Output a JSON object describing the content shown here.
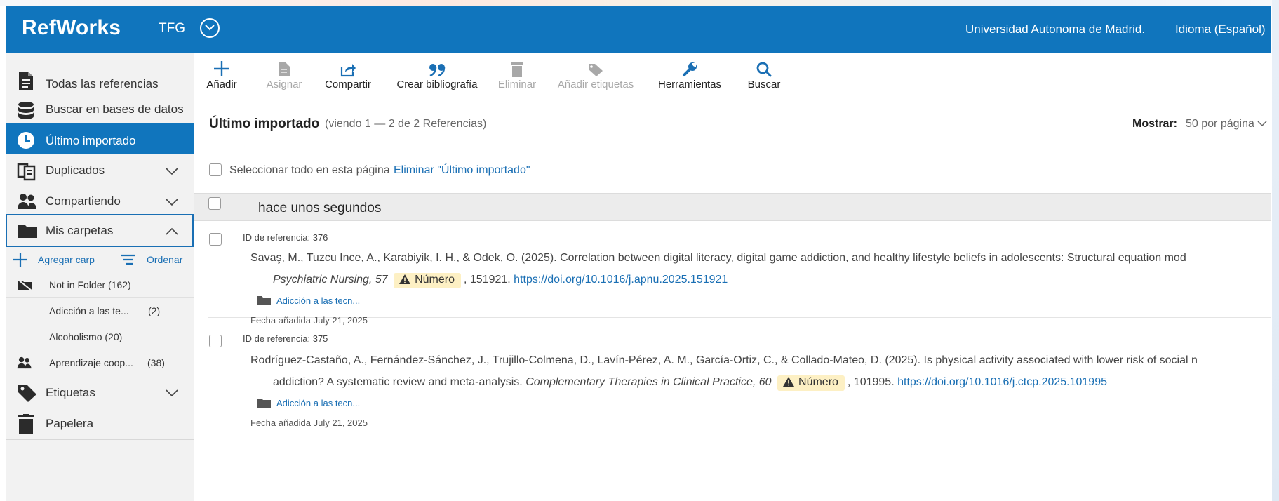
{
  "header": {
    "logo": "RefWorks",
    "project": "TFG",
    "institution": "Universidad Autonoma de Madrid.",
    "language": "Idioma (Español)"
  },
  "sidebar": {
    "items": [
      {
        "label": "Todas las referencias",
        "icon": "document-icon"
      },
      {
        "label": "Buscar en bases de datos",
        "icon": "database-icon"
      },
      {
        "label": "Último importado",
        "icon": "clock-icon",
        "active": true
      },
      {
        "label": "Duplicados",
        "icon": "duplicate-icon"
      },
      {
        "label": "Compartiendo",
        "icon": "users-icon"
      },
      {
        "label": "Mis carpetas",
        "icon": "folder-icon",
        "expanded": true
      }
    ],
    "folder_tools": {
      "add": "Agregar carp",
      "order": "Ordenar"
    },
    "folders": [
      {
        "label": "Not in Folder (162)",
        "icon": "folder-off-icon"
      },
      {
        "label": "Adicción a las te...",
        "count": "(2)"
      },
      {
        "label": "Alcoholismo (20)"
      },
      {
        "label": "Aprendizaje coop...",
        "count": "(38)",
        "icon": "users-icon"
      }
    ],
    "bottom_items": [
      {
        "label": "Etiquetas",
        "icon": "tag-icon"
      },
      {
        "label": "Papelera",
        "icon": "trash-icon"
      }
    ]
  },
  "toolbar": {
    "add": "Añadir",
    "assign": "Asignar",
    "share": "Compartir",
    "bibliography": "Crear bibliografía",
    "delete": "Eliminar",
    "add_tags": "Añadir etiquetas",
    "tools": "Herramientas",
    "search": "Buscar"
  },
  "main": {
    "title": "Último importado",
    "subtitle": "(viendo 1 — 2 de 2 Referencias)",
    "show_label": "Mostrar:",
    "show_value": "50 por página",
    "select_all": "Seleccionar todo en esta página",
    "remove_link": "Eliminar \"Último importado\"",
    "group_label": "hace unos segundos"
  },
  "references": [
    {
      "id_label": "ID de referencia: 376",
      "line1": "Savaş, M., Tuzcu Ince, A., Karabiyik, I. H., & Odek, O. (2025). Correlation between digital literacy, digital game addiction, and healthy lifestyle beliefs in adolescents: Structural equation mod",
      "line2_prefix": "",
      "journal": "Psychiatric Nursing, 57",
      "badge": "Número",
      "pages": ", 151921.",
      "doi": "https://doi.org/10.1016/j.apnu.2025.151921",
      "folder": "Adicción a las tecn...",
      "date_added": "Fecha añadida July 21, 2025"
    },
    {
      "id_label": "ID de referencia: 375",
      "line1": "Rodríguez-Castaño, A., Fernández-Sánchez, J., Trujillo-Colmena, D., Lavín-Pérez, A. M., García-Ortiz, C., & Collado-Mateo, D. (2025). Is physical activity associated with lower risk of social n",
      "line2_prefix": "addiction? A systematic review and meta-analysis.",
      "journal": "Complementary Therapies in Clinical Practice, 60",
      "badge": "Número",
      "pages": ", 101995.",
      "doi": "https://doi.org/10.1016/j.ctcp.2025.101995",
      "folder": "Adicción a las tecn...",
      "date_added": "Fecha añadida July 21, 2025"
    }
  ],
  "colors": {
    "brand": "#1075bd",
    "link": "#1a6fb4",
    "badge_bg": "#fdf0c4"
  }
}
